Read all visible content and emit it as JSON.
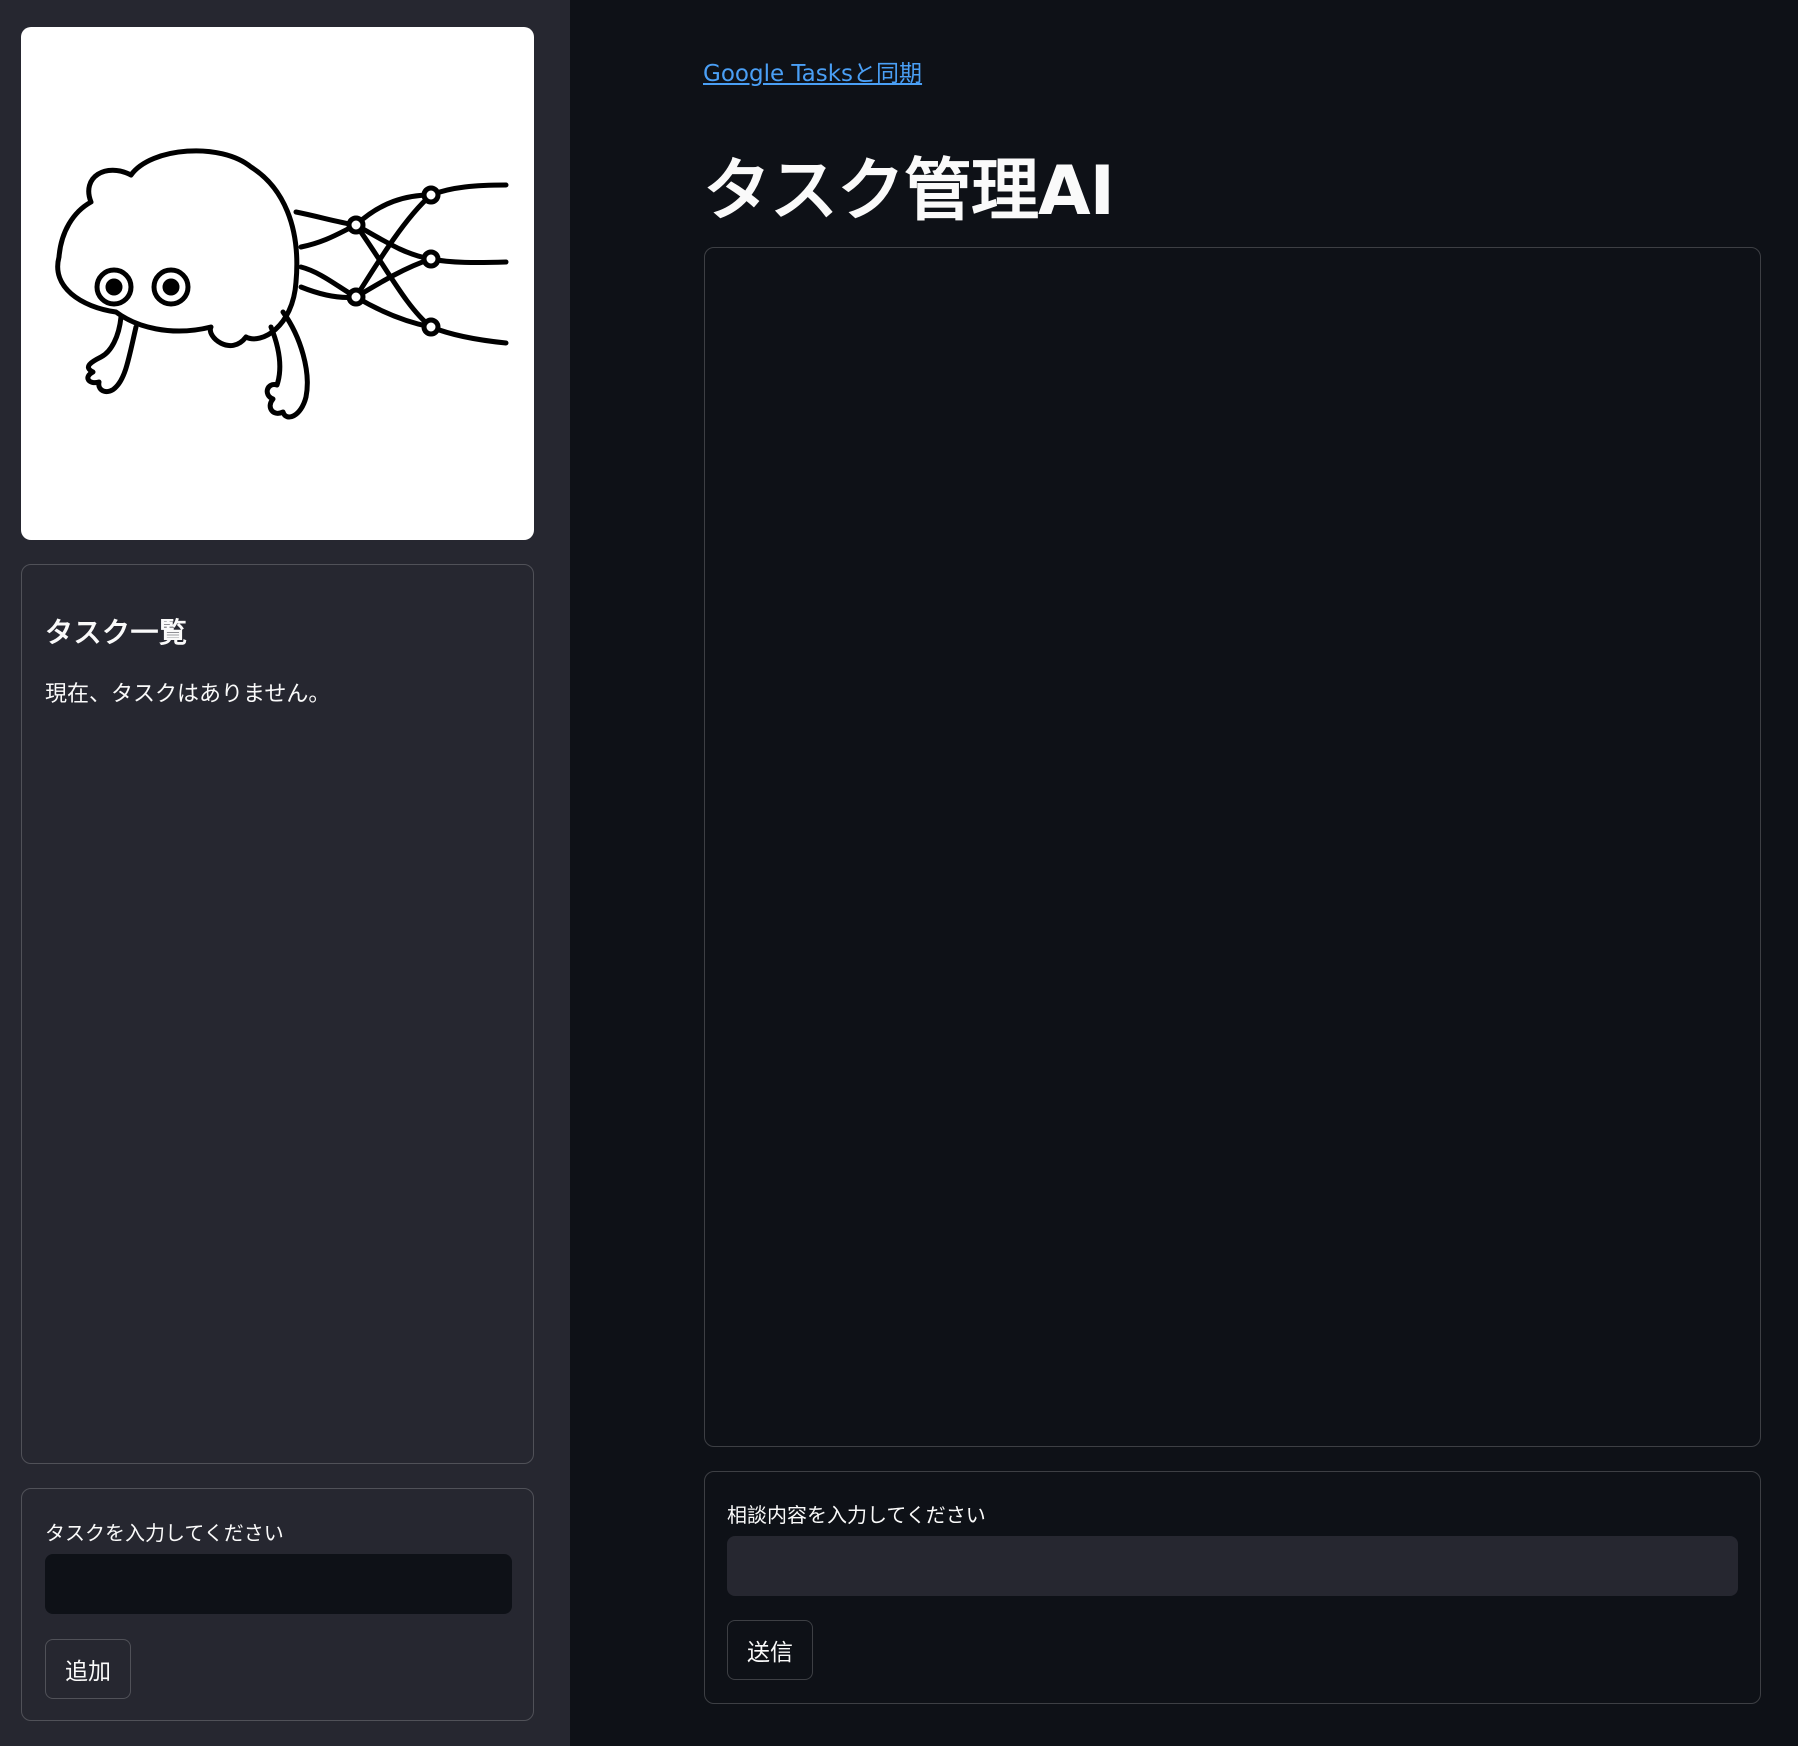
{
  "sidebar": {
    "logo_icon": "frog-neural-network-icon",
    "task_list": {
      "heading": "タスク一覧",
      "empty_message": "現在、タスクはありません。"
    },
    "task_form": {
      "label": "タスクを入力してください",
      "input_value": "",
      "add_label": "追加"
    }
  },
  "main": {
    "sync_link": "Google Tasksと同期",
    "title": "タスク管理AI",
    "consult_form": {
      "label": "相談内容を入力してください",
      "input_value": "",
      "send_label": "送信"
    }
  },
  "colors": {
    "background": "#0e1117",
    "sidebar": "#262730",
    "link": "#4a9ff5",
    "text": "#fafafa"
  }
}
